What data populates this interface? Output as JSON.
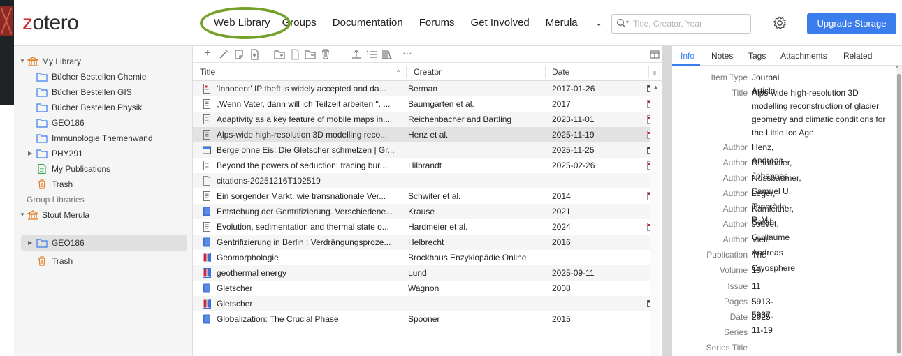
{
  "header": {
    "logo_z": "z",
    "logo_rest": "otero",
    "nav": [
      {
        "label": "Web Library"
      },
      {
        "label": "Groups"
      },
      {
        "label": "Documentation"
      },
      {
        "label": "Forums"
      },
      {
        "label": "Get Involved"
      },
      {
        "label": "Merula"
      }
    ],
    "user_chevron": "⌄",
    "search_placeholder": "Title, Creator, Year",
    "upgrade_label": "Upgrade Storage",
    "accent": "#3b7ded",
    "highlight_color": "#73a12a"
  },
  "sidebar": {
    "my_library": "My Library",
    "collections": [
      {
        "label": "Bücher Bestellen Chemie"
      },
      {
        "label": "Bücher Bestellen GIS"
      },
      {
        "label": "Bücher Bestellen Physik"
      },
      {
        "label": "GEO186"
      },
      {
        "label": "Immunologie Themenwand"
      },
      {
        "label": "PHY291"
      },
      {
        "label": "My Publications"
      },
      {
        "label": "Trash"
      }
    ],
    "group_heading": "Group Libraries",
    "group_name": "Stout Merula",
    "group_items": [
      {
        "label": "GEO186"
      },
      {
        "label": "Trash"
      }
    ]
  },
  "list": {
    "columns": {
      "title": "Title",
      "creator": "Creator",
      "date": "Date",
      "sort_arrow": "^",
      "more": "⋯"
    },
    "rows": [
      {
        "title": "'Innocent' IP theft is widely accepted and da...",
        "creator": "Berman",
        "date": "2017-01-26",
        "icon": "newspaper-icon",
        "attach": "snapshot"
      },
      {
        "title": "„Wenn Vater, dann will ich Teilzeit arbeiten \". ...",
        "creator": "Baumgarten et al.",
        "date": "2017",
        "icon": "article-icon",
        "attach": "pdf"
      },
      {
        "title": "Adaptivity as a key feature of mobile maps in...",
        "creator": "Reichenbacher and Bartling",
        "date": "2023-11-01",
        "icon": "article-icon",
        "attach": "pdf"
      },
      {
        "title": "Alps-wide high-resolution 3D modelling reco...",
        "creator": "Henz et al.",
        "date": "2025-11-19",
        "icon": "article-icon",
        "attach": "pdf"
      },
      {
        "title": "Berge ohne Eis: Die Gletscher schmelzen | Gr...",
        "creator": "",
        "date": "2025-11-25",
        "icon": "webpage-icon",
        "attach": "snapshot"
      },
      {
        "title": "Beyond the powers of seduction: tracing bur...",
        "creator": "Hilbrandt",
        "date": "2025-02-26",
        "icon": "article-icon",
        "attach": "pdf"
      },
      {
        "title": "citations-20251216T102519",
        "creator": "",
        "date": "",
        "icon": "document-icon",
        "attach": ""
      },
      {
        "title": "Ein sorgender Markt: wie transnationale Ver...",
        "creator": "Schwiter et al.",
        "date": "2014",
        "icon": "article-icon",
        "attach": "pdf"
      },
      {
        "title": "Entstehung der Gentrifizierung. Verschiedene...",
        "creator": "Krause",
        "date": "2021",
        "icon": "book-icon",
        "attach": ""
      },
      {
        "title": "Evolution, sedimentation and thermal state o...",
        "creator": "Hardmeier et al.",
        "date": "2024",
        "icon": "article-icon",
        "attach": "pdf"
      },
      {
        "title": "Gentrifizierung in Berlin : Verdrängungsproze...",
        "creator": "Helbrecht",
        "date": "2016",
        "icon": "book-icon",
        "attach": ""
      },
      {
        "title": "Geomorphologie",
        "creator": "Brockhaus Enzyklopädie Online",
        "date": "",
        "icon": "encyclopedia-icon",
        "attach": ""
      },
      {
        "title": "geothermal energy",
        "creator": "Lund",
        "date": "2025-09-11",
        "icon": "encyclopedia-icon",
        "attach": ""
      },
      {
        "title": "Gletscher",
        "creator": "Wagnon",
        "date": "2008",
        "icon": "book-icon",
        "attach": ""
      },
      {
        "title": "Gletscher",
        "creator": "",
        "date": "",
        "icon": "encyclopedia-icon",
        "attach": "snapshot"
      },
      {
        "title": "Globalization: The Crucial Phase",
        "creator": "Spooner",
        "date": "2015",
        "icon": "book-icon",
        "attach": ""
      }
    ]
  },
  "details": {
    "tabs": [
      "Info",
      "Notes",
      "Tags",
      "Attachments",
      "Related"
    ],
    "fields": [
      {
        "k": "Item Type",
        "v": "Journal Article"
      },
      {
        "k": "Title",
        "v": "Alps-wide high-resolution 3D modelling reconstruction of glacier geometry and climatic conditions for the Little Ice Age"
      },
      {
        "k": "Author",
        "v": "Henz, Andreas"
      },
      {
        "k": "Author",
        "v": "Reinthaler, Johannes"
      },
      {
        "k": "Author",
        "v": "Nussbaumer, Samuel U."
      },
      {
        "k": "Author",
        "v": "Leger, Tancrède P. M."
      },
      {
        "k": "Author",
        "v": "Kamleitner, Sarah"
      },
      {
        "k": "Author",
        "v": "Jouvet, Guillaume"
      },
      {
        "k": "Author",
        "v": "Vieli, Andreas"
      },
      {
        "k": "Publication",
        "v": "The Cryosphere"
      },
      {
        "k": "Volume",
        "v": "19"
      },
      {
        "k": "Issue",
        "v": "11"
      },
      {
        "k": "Pages",
        "v": "5913-5937"
      },
      {
        "k": "Date",
        "v": "2025-11-19"
      },
      {
        "k": "Series",
        "v": ""
      },
      {
        "k": "Series Title",
        "v": ""
      }
    ]
  }
}
